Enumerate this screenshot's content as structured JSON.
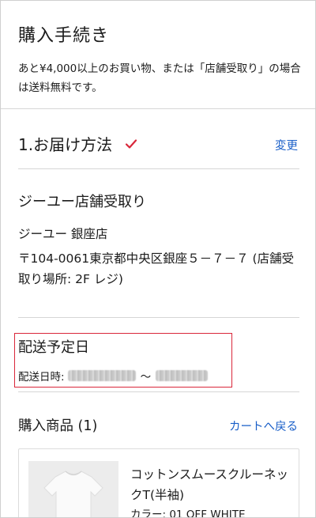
{
  "header": {
    "title": "購入手続き",
    "shipping_note": "あと¥4,000以上のお買い物、または「店舗受取り」の場合は送料無料です。"
  },
  "delivery_method": {
    "section_title": "1.お届け方法",
    "change_label": "変更",
    "method_name": "ジーユー店舗受取り",
    "store_name": "ジーユー 銀座店",
    "store_address": "〒104-0061東京都中央区銀座５－７－７ (店舗受取り場所: 2F レジ)"
  },
  "delivery_date": {
    "title": "配送予定日",
    "label": "配送日時:",
    "separator": "～"
  },
  "products": {
    "section_title": "購入商品 (1)",
    "back_to_cart_label": "カートへ戻る",
    "items": [
      {
        "name": "コットンスムースクルーネックT(半袖)",
        "color": "カラー: 01 OFF WHITE"
      }
    ]
  },
  "colors": {
    "link": "#1a5fc8",
    "check": "#d9273a",
    "highlight_border": "#d9273a",
    "divider": "#d6d6d6"
  },
  "icons": {
    "check": "check-icon"
  }
}
